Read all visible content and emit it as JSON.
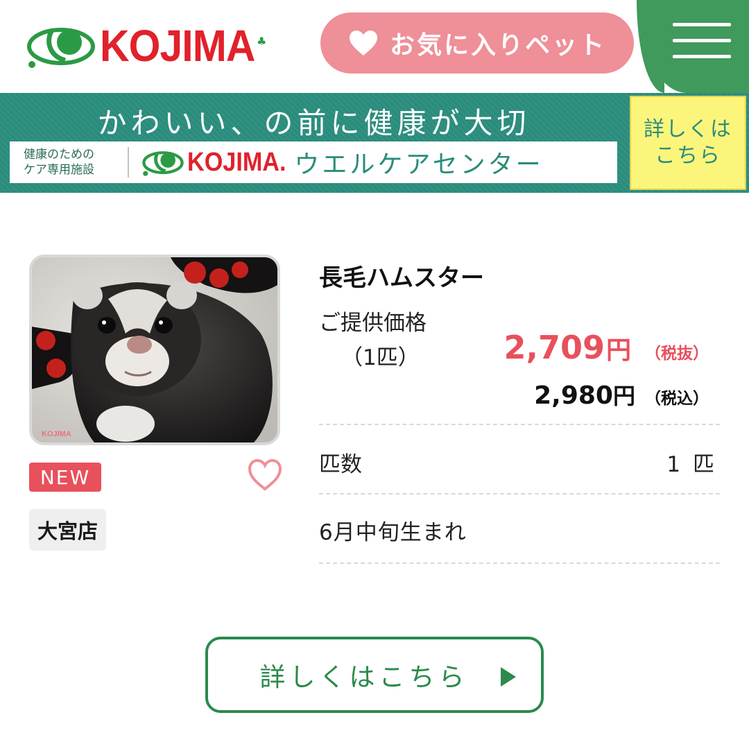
{
  "header": {
    "logo_text": "KOJIMA",
    "favorites_label": "お気に入りペット",
    "menu_icon": "hamburger-icon"
  },
  "banner": {
    "title": "かわいい、の前に健康が大切",
    "small_text_line1": "健康のための",
    "small_text_line2": "ケア専用施設",
    "logo_text": "KOJIMA.",
    "center_text": "ウエルケアセンター",
    "cta_line1": "詳しくは",
    "cta_line2": "こちら"
  },
  "pet": {
    "photo_alt": "ferret photo",
    "photo_watermark": "KOJIMA",
    "badge": "NEW",
    "store": "大宮店",
    "name": "長毛ハムスター",
    "price_label": "ご提供価格",
    "price_unit": "（1匹）",
    "price_ex_tax": "2,709",
    "price_in_tax": "2,980",
    "yen": "円",
    "tax_ex_label": "（税抜）",
    "tax_in_label": "（税込）",
    "count_label": "匹数",
    "count_value": "1 匹",
    "birth": "6月中旬生まれ"
  },
  "detail_button": {
    "label": "詳しくはこちら"
  },
  "colors": {
    "brand_green": "#3f9a5c",
    "button_green": "#2b8a4b",
    "favorite_pink": "#ef8f98",
    "price_red": "#e8505c",
    "logo_red": "#e1212b",
    "banner_teal": "#2a8c7c"
  }
}
